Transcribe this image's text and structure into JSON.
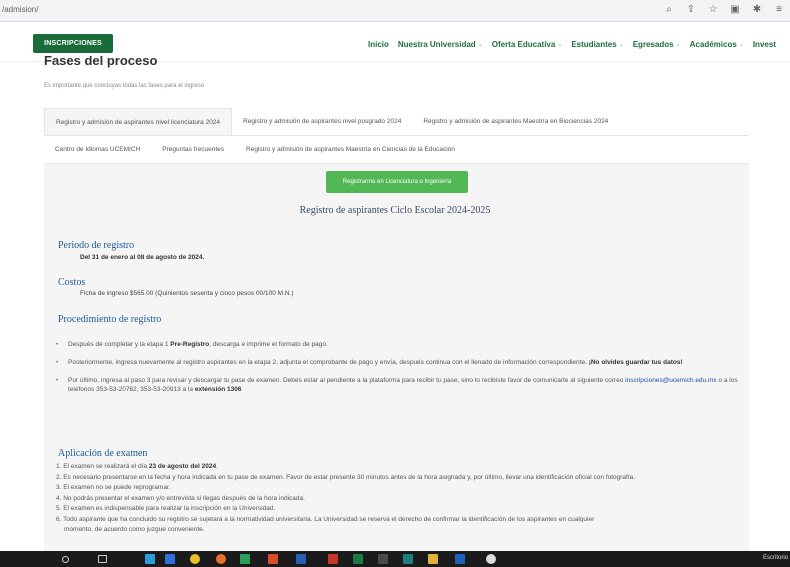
{
  "browser": {
    "url": "/admision/",
    "icons": [
      "zoom-icon",
      "share-icon",
      "star-icon",
      "extension-icon",
      "puzzle-icon",
      "menu-icon"
    ]
  },
  "nav": {
    "inscripciones": "INSCRIPCIONES",
    "items": [
      {
        "label": "Inicio",
        "chevron": false
      },
      {
        "label": "Nuestra Universidad",
        "chevron": true
      },
      {
        "label": "Oferta Educativa",
        "chevron": true
      },
      {
        "label": "Estudiantes",
        "chevron": true
      },
      {
        "label": "Egresados",
        "chevron": true
      },
      {
        "label": "Académicos",
        "chevron": true
      },
      {
        "label": "Invest",
        "chevron": false
      }
    ],
    "chevron_glyph": "⌄"
  },
  "page": {
    "title": "Fases del proceso",
    "subtitle": "Es importante que concluyas todas las fases para el ingreso"
  },
  "tabs": {
    "row1": [
      "Registro y admisión de aspirantes nivel licenciatura 2024",
      "Registro y admisión de aspirantes nivel posgrado 2024",
      "Registro y admisión de aspirantes Maestría en Biociencias 2024"
    ],
    "row2": [
      "Centro de Idiomas UCEMICH",
      "Preguntas frecuentes",
      "Registro y admisión de aspirantes Maestría en Ciencias de la Educación"
    ]
  },
  "content": {
    "register_button": "Registrarme en Licenciatura o Ingeniería",
    "registration_title": "Registro de aspirantes Ciclo Escolar 2024-2025",
    "periodo": {
      "heading": "Periodo de registro",
      "text": "Del 31 de enero al 08 de agosto de 2024."
    },
    "costos": {
      "heading": "Costos",
      "text": "Ficha de ingreso $565.00 (Quinientos sesenta y cinco pesos 00/100 M.N.)"
    },
    "procedimiento": {
      "heading": "Procedimiento de registro",
      "b1_pre": "Después de completar y la etapa 1 ",
      "b1_bold": "Pre-Registro",
      "b1_post": ", descarga e imprime el formato de pago.",
      "b2_pre": "Posteriormente, ingresa nuevamente al registro aspirantes en la etapa 2, adjunta el comprobante de pago y envía, después continua con el llenado de información correspondiente. ",
      "b2_bold": "¡No olvides guardar tus datos!",
      "b3_pre": "Por último, ingresa al paso 3 para revisar y descargar tu pase de examen. Debes estar al pendiente a la plataforma para recibir tu pase, sino lo recibiste favor de comunicarte al siguiente correo ",
      "b3_link": "inscripciones@ucemich.edu.mx",
      "b3_mid": " o a los teléfonos 353-53-20762, 353-53-20913 a la ",
      "b3_bold": "extensión 1306"
    },
    "examen": {
      "heading": "Aplicación de examen",
      "i1_pre": "1. El examen se realizará el día ",
      "i1_bold": "23 de agosto del 2024",
      "i1_post": ".",
      "i2": "2. Es necesario presentarse en la fecha y hora indicada en tu pase de examen. Favor de estar presente 30 minutos antes de la hora asignada y, por último, llevar una identificación oficial con fotografía.",
      "i3": "3. El examen  no se puede reprogramar.",
      "i4": "4. No podrás presentar el examen y/o entrevista si llegas después de la hora indicada.",
      "i5": "5. El examen es indispensable para realizar la inscripción en la Universidad.",
      "i6a": "6. Todo aspirante que ha concluido su registro se sujetará a la normatividad universitaria. La Universidad se reserva el derecho de confirmar la identificación de los aspirantes en cualquier",
      "i6b": "    momento, de acuerdo como juzgue conveniente."
    }
  },
  "taskbar": {
    "text": "Escritorio",
    "colors": {
      "windows": "#3c8dde",
      "edge": "#2d9cdb",
      "files": "#2f6fd8",
      "chrome": "#e7c02c",
      "firefox": "#e8722c",
      "store": "#2d9f5c",
      "office": "#d94e2a",
      "word": "#2b5eb5",
      "pdf": "#c7362b",
      "excel": "#1e7b45",
      "calc": "#4a4a4a",
      "teams": "#1b7f7f",
      "folder": "#e2b33b",
      "mail": "#1c62b8",
      "chromium": "#dddddd"
    }
  }
}
